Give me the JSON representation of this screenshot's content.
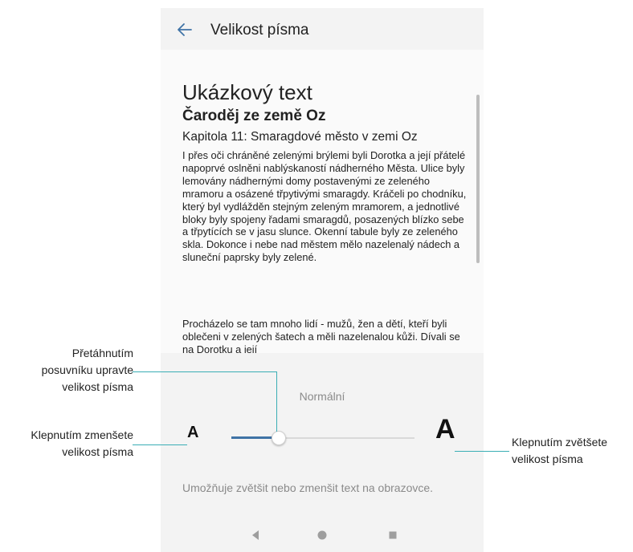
{
  "header": {
    "title": "Velikost písma",
    "back_icon": "arrow-left-icon"
  },
  "preview": {
    "heading": "Ukázkový text",
    "subheading": "Čaroděj ze země Oz",
    "chapter": "Kapitola 11: Smaragdové město v zemi Oz",
    "paragraph1": "I přes oči chráněné zelenými brýlemi byli Dorotka a její přátelé napoprvé oslněni nablýskaností nádherného Města. Ulice byly lemovány nádhernými domy postavenými ze zeleného mramoru a osázené třpytivými smaragdy. Kráčeli po chodníku, který byl vydlážděn stejným zeleným mramorem, a jednotlivé bloky byly spojeny řadami smaragdů, posazených blízko sebe a třpytících se v jasu slunce. Okenní tabule byly ze zeleného skla. Dokonce i nebe nad městem mělo nazelenalý nádech a sluneční paprsky byly zelené.",
    "paragraph2": "Procházelo se tam mnoho lidí - mužů, žen a dětí, kteří byli oblečeni v zelených šatech a měli nazelenalou kůži. Dívali se na Dorotku a její"
  },
  "font_size": {
    "level_label": "Normální",
    "small_label": "A",
    "large_label": "A",
    "slider_value_fraction": 0.26,
    "accent_color": "#3f73a6",
    "description": "Umožňuje zvětšit nebo zmenšit text na obrazovce."
  },
  "navbar": {
    "back_icon": "nav-back-triangle-icon",
    "home_icon": "nav-home-circle-icon",
    "recents_icon": "nav-recents-square-icon"
  },
  "annotations": {
    "slider": "Přetáhnutím\nposuvníku upravte\nvelikost písma",
    "decrease": "Klepnutím zmenšete\nvelikost písma",
    "increase": "Klepnutím zvětšete\nvelikost písma",
    "leader_color": "#3aaeb5"
  }
}
